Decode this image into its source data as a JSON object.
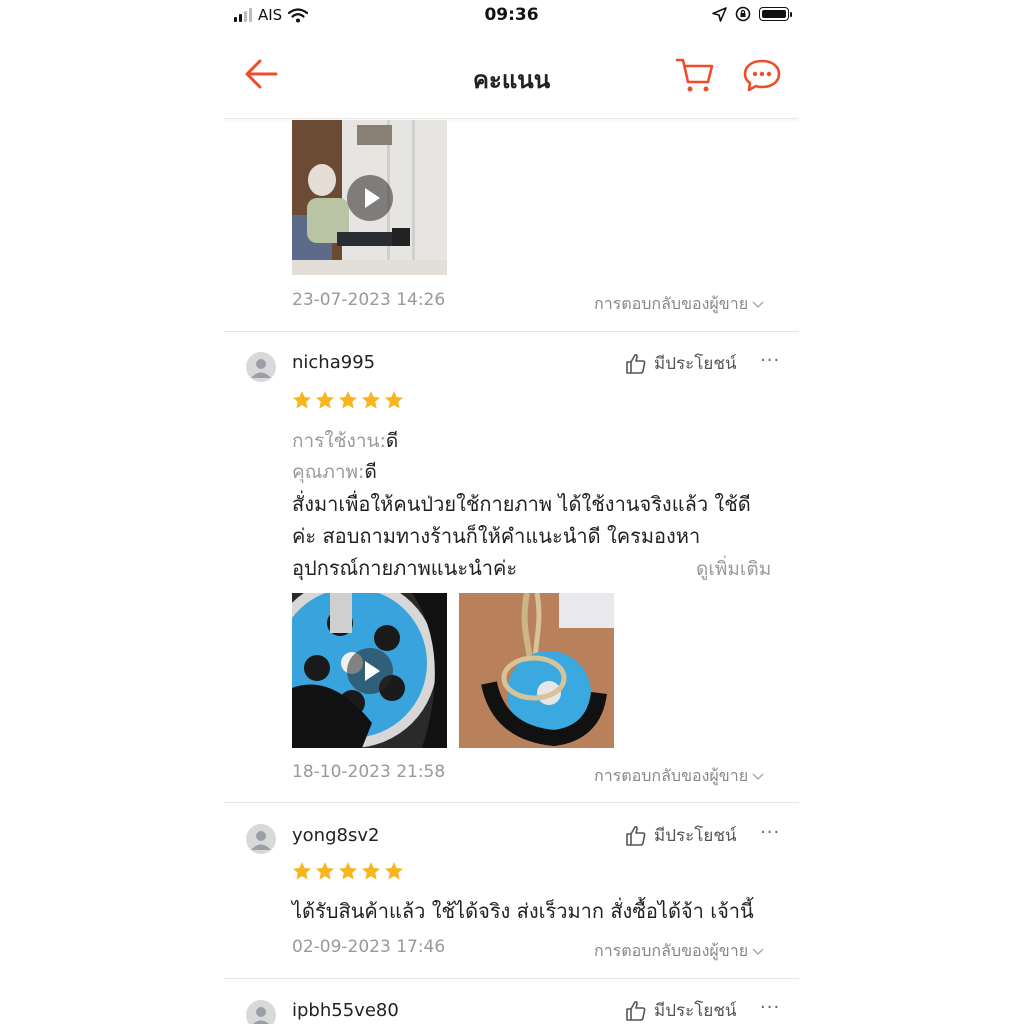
{
  "status_bar": {
    "carrier": "AIS",
    "time": "09:36"
  },
  "header": {
    "title": "คะแนน",
    "back_icon": "back-arrow-icon",
    "cart_icon": "cart-icon",
    "chat_icon": "chat-icon"
  },
  "accent_color": "#ee4d2d",
  "star_color": "#f7b51e",
  "reviews": [
    {
      "date": "23-07-2023 14:26",
      "reply_label": "การตอบกลับของผู้ขาย",
      "media": [
        {
          "type": "video",
          "label": "elderly-patient-exercise-video"
        }
      ]
    },
    {
      "username": "nicha995",
      "helpful_label": "มีประโยชน์",
      "more": "···",
      "rating": 5,
      "attributes": [
        {
          "key": "การใช้งาน:",
          "value": "ดี"
        },
        {
          "key": "คุณภาพ:",
          "value": "ดี"
        }
      ],
      "text_lines": [
        "สั่งมาเพื่อให้คนป่วยใช้กายภาพ ได้ใช้งานจริงแล้ว ใช้ดี",
        "ค่ะ  สอบถามทางร้านก็ให้คำแนะนำดี  ใครมองหา",
        "อุปกรณ์กายภาพแนะนำค่ะ"
      ],
      "see_more": "ดูเพิ่มเติม",
      "media": [
        {
          "type": "video",
          "label": "blue-pulley-video"
        },
        {
          "type": "image",
          "label": "pulley-rope-photo"
        }
      ],
      "date": "18-10-2023 21:58",
      "reply_label": "การตอบกลับของผู้ขาย"
    },
    {
      "username": "yong8sv2",
      "helpful_label": "มีประโยชน์",
      "more": "···",
      "rating": 5,
      "text_lines": [
        "ได้รับสินค้าแล้ว  ใช้ได้จริง ส่งเร็วมาก สั่งซื้อได้จ้า เจ้านี้"
      ],
      "date": "02-09-2023 17:46",
      "reply_label": "การตอบกลับของผู้ขาย"
    },
    {
      "username": "ipbh55ve80",
      "helpful_label": "มีประโยชน์",
      "more": "···"
    }
  ]
}
